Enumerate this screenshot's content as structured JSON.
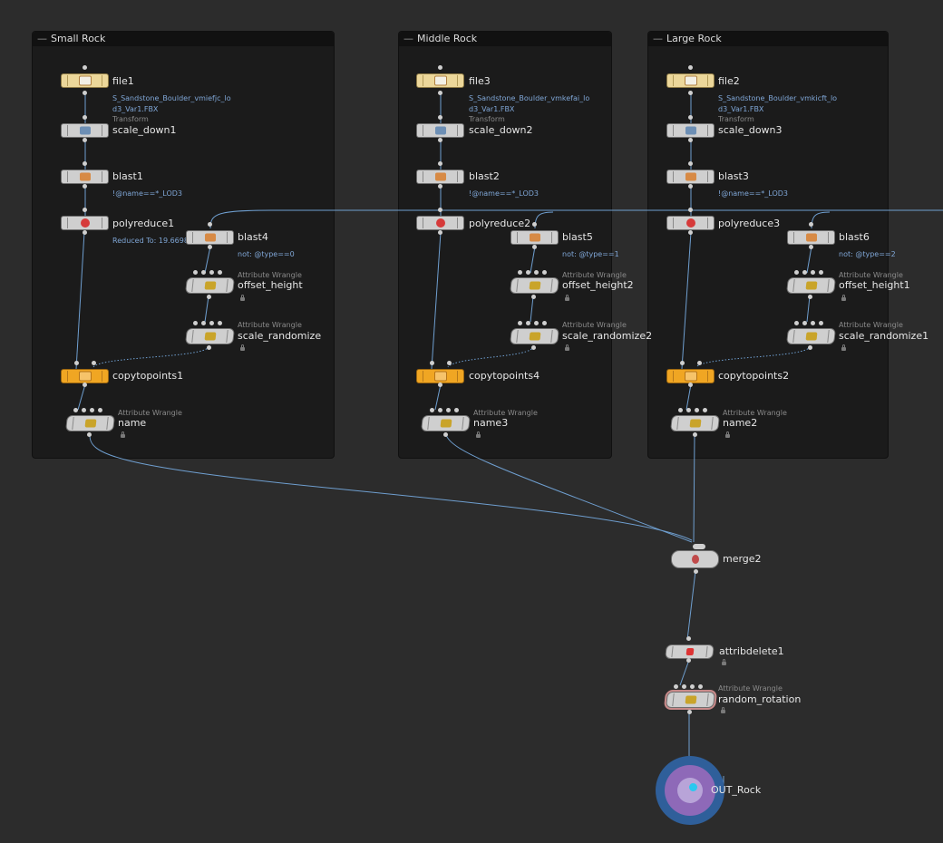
{
  "network_boxes": [
    {
      "title": "Small Rock"
    },
    {
      "title": "Middle Rock"
    },
    {
      "title": "Large Rock"
    }
  ],
  "nodes": {
    "file1": {
      "name": "file1",
      "info": [
        "S_Sandstone_Boulder_vmiefjc_lo",
        "d3_Var1.FBX"
      ]
    },
    "file3": {
      "name": "file3",
      "info": [
        "S_Sandstone_Boulder_vmkefai_lo",
        "d3_Var1.FBX"
      ]
    },
    "file2": {
      "name": "file2",
      "info": [
        "S_Sandstone_Boulder_vmkicft_lo",
        "d3_Var1.FBX"
      ]
    },
    "scale_down1": {
      "name": "scale_down1",
      "type": "Transform"
    },
    "scale_down2": {
      "name": "scale_down2",
      "type": "Transform"
    },
    "scale_down3": {
      "name": "scale_down3",
      "type": "Transform"
    },
    "blast1": {
      "name": "blast1",
      "info": "!@name==*_LOD3"
    },
    "blast2": {
      "name": "blast2",
      "info": "!@name==*_LOD3"
    },
    "blast3": {
      "name": "blast3",
      "info": "!@name==*_LOD3"
    },
    "polyreduce1": {
      "name": "polyreduce1",
      "info": "Reduced To: 19.6698"
    },
    "polyreduce2": {
      "name": "polyreduce2"
    },
    "polyreduce3": {
      "name": "polyreduce3"
    },
    "blast4": {
      "name": "blast4",
      "info": "not: @type==0"
    },
    "blast5": {
      "name": "blast5",
      "info": "not: @type==1"
    },
    "blast6": {
      "name": "blast6",
      "info": "not: @type==2"
    },
    "offset_height": {
      "name": "offset_height",
      "type": "Attribute Wrangle"
    },
    "offset_height2": {
      "name": "offset_height2",
      "type": "Attribute Wrangle"
    },
    "offset_height1": {
      "name": "offset_height1",
      "type": "Attribute Wrangle"
    },
    "scale_randomize": {
      "name": "scale_randomize",
      "type": "Attribute Wrangle"
    },
    "scale_randomize2": {
      "name": "scale_randomize2",
      "type": "Attribute Wrangle"
    },
    "scale_randomize1": {
      "name": "scale_randomize1",
      "type": "Attribute Wrangle"
    },
    "copytopoints1": {
      "name": "copytopoints1"
    },
    "copytopoints4": {
      "name": "copytopoints4"
    },
    "copytopoints2": {
      "name": "copytopoints2"
    },
    "name": {
      "name": "name",
      "type": "Attribute Wrangle"
    },
    "name3": {
      "name": "name3",
      "type": "Attribute Wrangle"
    },
    "name2": {
      "name": "name2",
      "type": "Attribute Wrangle"
    },
    "merge2": {
      "name": "merge2"
    },
    "attribdelete1": {
      "name": "attribdelete1"
    },
    "random_rotation": {
      "name": "random_rotation",
      "type": "Attribute Wrangle"
    },
    "OUT_Rock": {
      "name": "OUT_Rock"
    }
  },
  "colors": {
    "background": "#2c2c2c",
    "network_box": "#1b1b1b",
    "wire": "#6f9fd0",
    "info_text": "#7fa6d6",
    "file_node": "#ecd79a",
    "copy_node": "#f0a623",
    "null_outer": "#2f5f9a",
    "null_inner": "#8e69b8"
  },
  "icons": {
    "file": "folder-icon",
    "transform": "transform-icon",
    "blast": "blast-icon",
    "polyreduce": "sphere-icon",
    "wrangle": "wrangle-icon",
    "copytopoints": "copy-icon",
    "merge": "merge-icon",
    "attribdelete": "delete-x-icon",
    "null": "null-icon"
  }
}
